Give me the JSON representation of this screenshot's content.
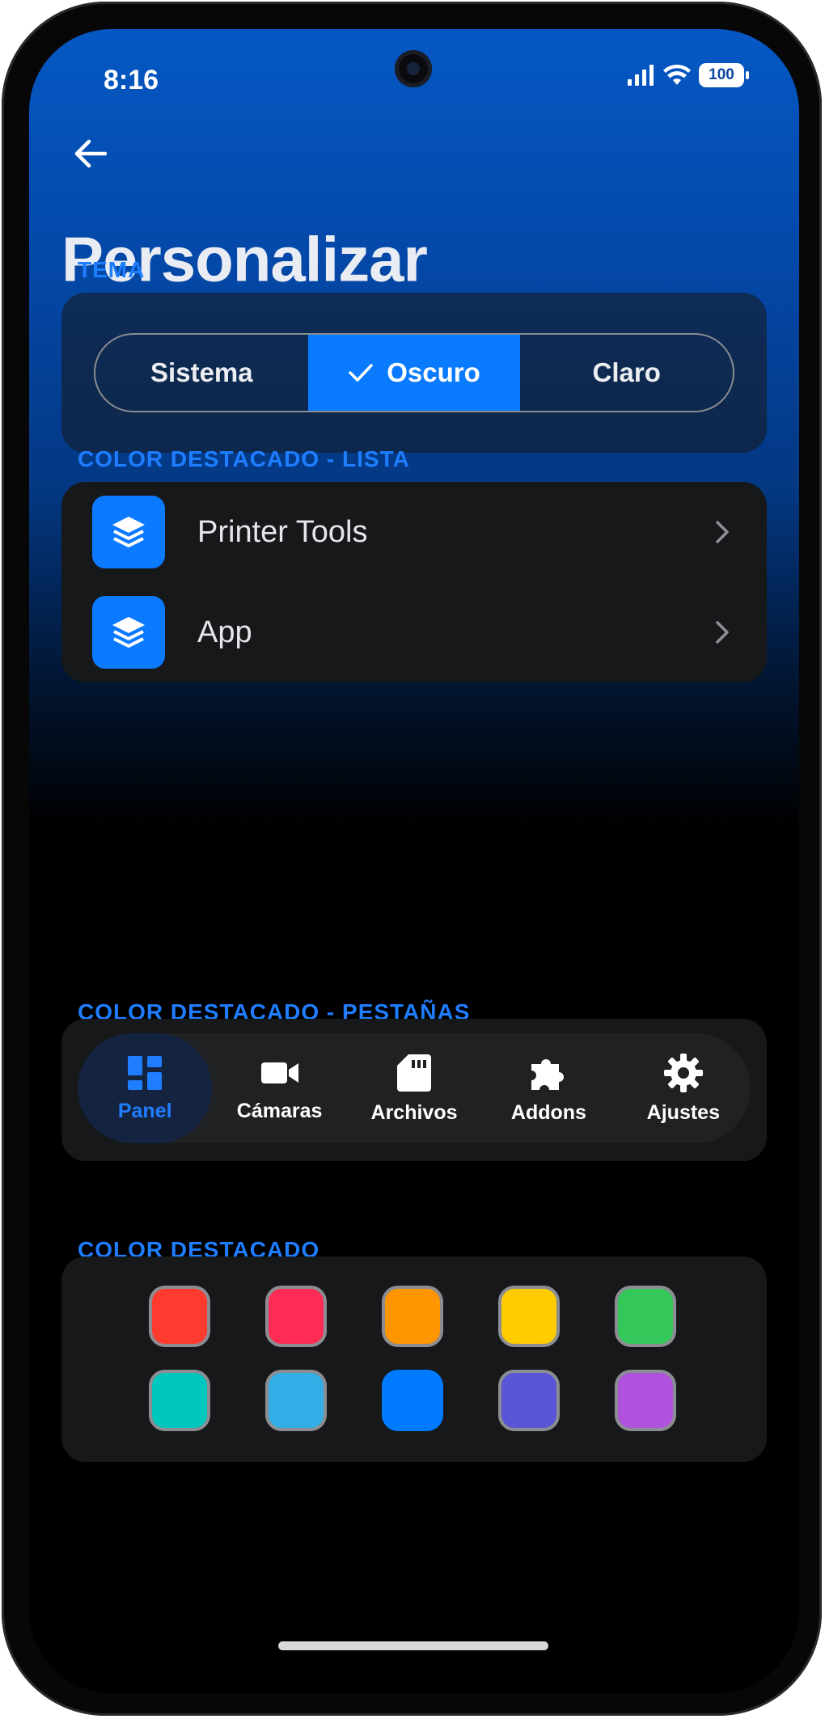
{
  "status_bar": {
    "time": "8:16",
    "battery": "100"
  },
  "page": {
    "title": "Personalizar"
  },
  "theme": {
    "label": "TEMA",
    "options": [
      {
        "label": "Sistema",
        "selected": false
      },
      {
        "label": "Oscuro",
        "selected": true
      },
      {
        "label": "Claro",
        "selected": false
      }
    ]
  },
  "list_accent": {
    "label": "COLOR DESTACADO - LISTA",
    "items": [
      {
        "label": "Printer Tools",
        "icon": "layers-icon"
      },
      {
        "label": "App",
        "icon": "layers-icon"
      }
    ]
  },
  "tabs_accent": {
    "label": "COLOR DESTACADO - PESTAÑAS",
    "tabs": [
      {
        "label": "Panel",
        "icon": "dashboard-icon",
        "active": true
      },
      {
        "label": "Cámaras",
        "icon": "video-camera-icon",
        "active": false
      },
      {
        "label": "Archivos",
        "icon": "sd-card-icon",
        "active": false
      },
      {
        "label": "Addons",
        "icon": "puzzle-icon",
        "active": false
      },
      {
        "label": "Ajustes",
        "icon": "gear-icon",
        "active": false
      }
    ]
  },
  "accent_color": {
    "label": "COLOR DESTACADO",
    "colors": [
      "#ff3b30",
      "#ff2d55",
      "#ff9500",
      "#ffcc00",
      "#34c759",
      "#00c7be",
      "#32ade6",
      "#007aff",
      "#5856d6",
      "#af52de"
    ],
    "selected": "#007aff"
  },
  "colors": {
    "accent": "#0a7bff",
    "label_accent": "#1f7dff",
    "card": "#171819"
  }
}
